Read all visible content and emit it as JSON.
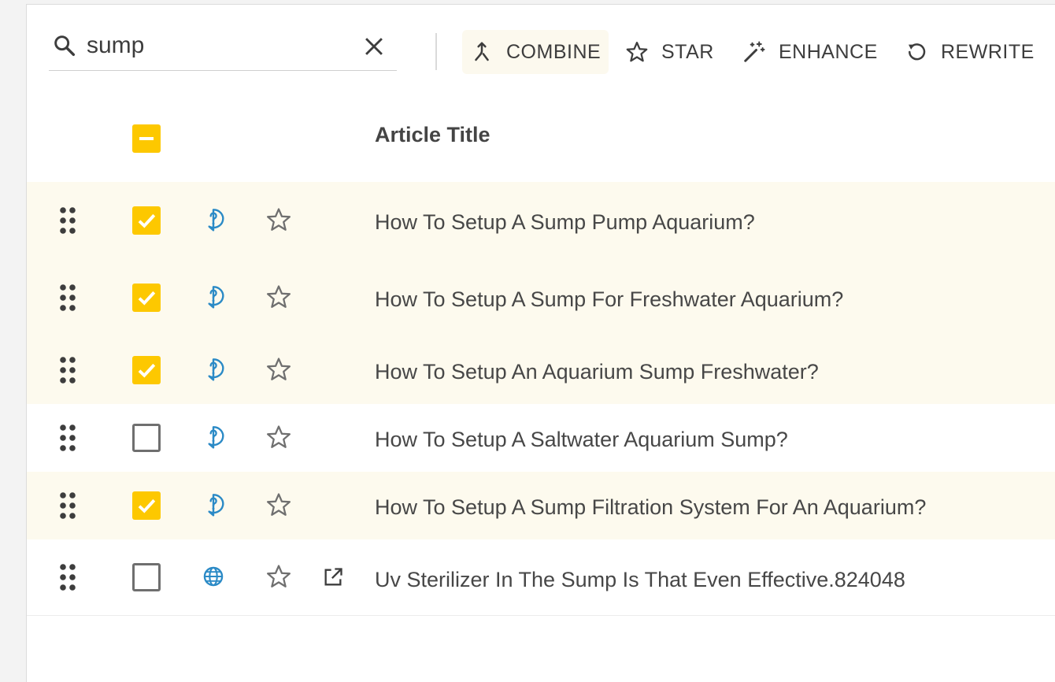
{
  "search": {
    "value": "sump",
    "placeholder": ""
  },
  "toolbar": {
    "combine_label": "COMBINE",
    "star_label": "STAR",
    "enhance_label": "ENHANCE",
    "rewrite_label": "REWRITE"
  },
  "table": {
    "column_title": "Article Title",
    "header_checkbox_state": "indeterminate",
    "rows": [
      {
        "title": "How To Setup A Sump Pump Aquarium?",
        "checked": true,
        "type_icon": "question-bubble-icon",
        "external_link": false
      },
      {
        "title": "How To Setup A Sump For Freshwater Aquarium?",
        "checked": true,
        "type_icon": "question-bubble-icon",
        "external_link": false
      },
      {
        "title": "How To Setup An Aquarium Sump Freshwater?",
        "checked": true,
        "type_icon": "question-bubble-icon",
        "external_link": false
      },
      {
        "title": "How To Setup A Saltwater Aquarium Sump?",
        "checked": false,
        "type_icon": "question-bubble-icon",
        "external_link": false
      },
      {
        "title": "How To Setup A Sump Filtration System For An Aquarium?",
        "checked": true,
        "type_icon": "question-bubble-icon",
        "external_link": false
      },
      {
        "title": "Uv Sterilizer In The Sump Is That Even Effective.824048",
        "checked": false,
        "type_icon": "globe-icon",
        "external_link": true
      }
    ]
  },
  "colors": {
    "accent": "#fdc800",
    "selected_row": "#fdfaee",
    "icon_blue": "#2b8ac6",
    "text": "#3d3d3d"
  }
}
